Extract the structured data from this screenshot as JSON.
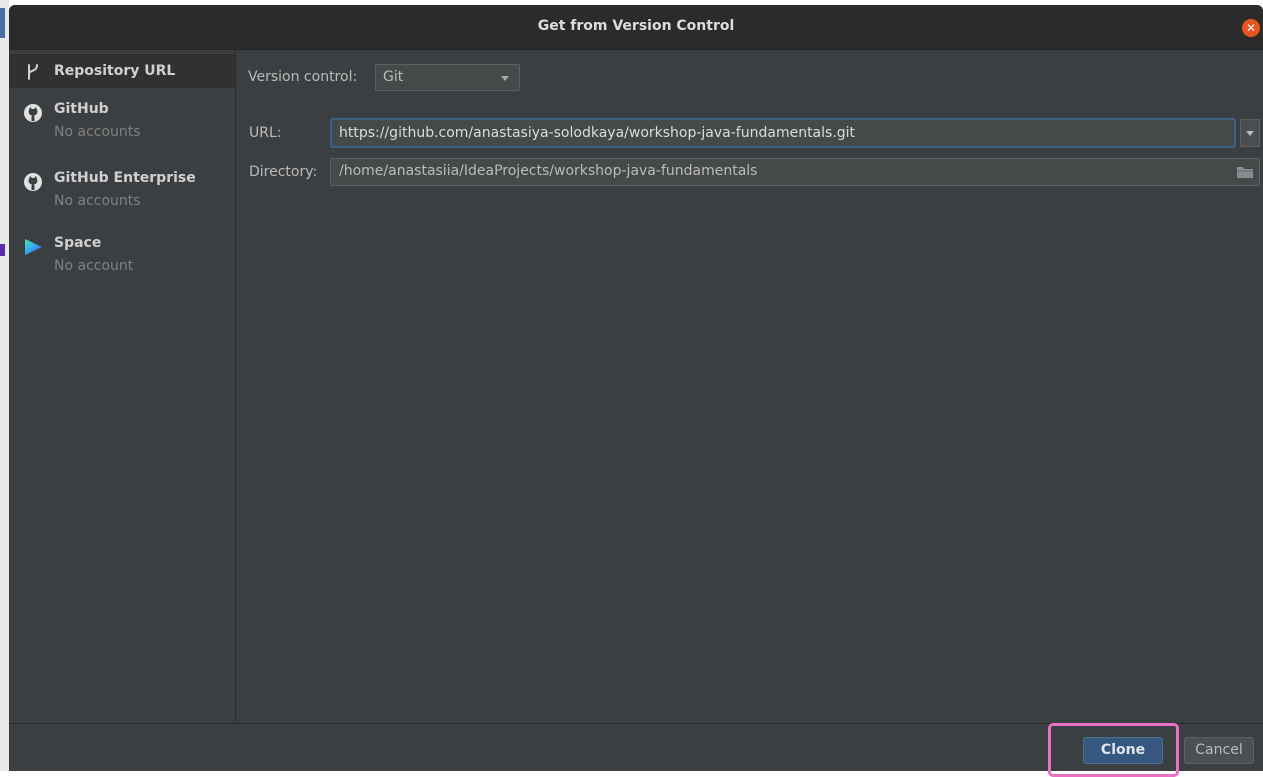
{
  "dialog": {
    "title": "Get from Version Control"
  },
  "sidebar": {
    "items": [
      {
        "label": "Repository URL",
        "sub": "",
        "icon": "branch-icon"
      },
      {
        "label": "GitHub",
        "sub": "No accounts",
        "icon": "github-icon"
      },
      {
        "label": "GitHub Enterprise",
        "sub": "No accounts",
        "icon": "github-icon"
      },
      {
        "label": "Space",
        "sub": "No account",
        "icon": "space-icon"
      }
    ]
  },
  "form": {
    "version_control_label": "Version control:",
    "version_control_value": "Git",
    "url_label": "URL:",
    "url_value": "https://github.com/anastasiya-solodkaya/workshop-java-fundamentals.git",
    "directory_label": "Directory:",
    "directory_value": "/home/anastasiia/IdeaProjects/workshop-java-fundamentals"
  },
  "footer": {
    "clone_label": "Clone",
    "cancel_label": "Cancel"
  },
  "colors": {
    "dialog_bg": "#3c3f41",
    "accent": "#365880",
    "close": "#e95420",
    "highlight": "#e86fc4"
  }
}
